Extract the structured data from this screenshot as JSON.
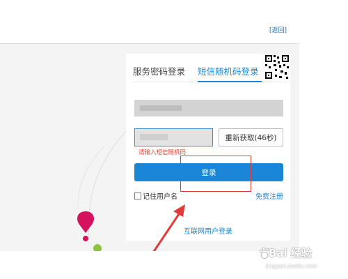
{
  "header": {
    "back_link": "[返回]"
  },
  "login": {
    "tabs": [
      {
        "label": "服务密码登录",
        "active": false
      },
      {
        "label": "短信随机码登录",
        "active": true
      }
    ],
    "phone_input": {
      "value": ""
    },
    "code_input": {
      "value": ""
    },
    "refresh_button": "重新获取(46秒)",
    "error_message": "请输入短信随机码",
    "login_button": "登录",
    "remember_label": "记住用户名",
    "register_link": "免费注册",
    "internet_login_link": "互联网用户登录"
  },
  "colors": {
    "accent": "#1b86d6",
    "error": "#e0453a",
    "annotation": "#e23a3a"
  },
  "watermark": {
    "main": "Bai 经验",
    "sub": "jingyan.baidu.com"
  }
}
